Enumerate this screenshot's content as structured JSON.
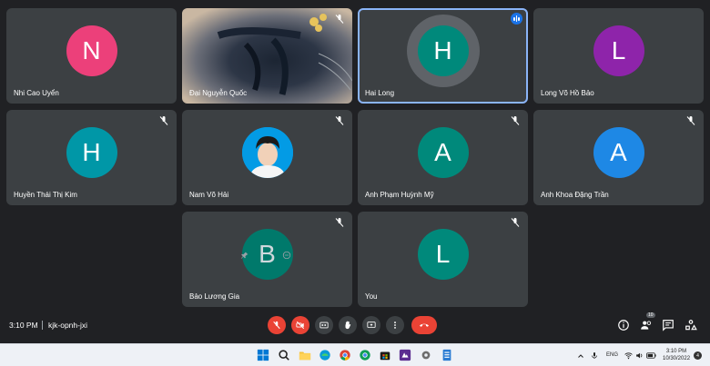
{
  "tiles": [
    {
      "name": "Nhi Cao Uyển",
      "initial": "N",
      "color": "#ec407a",
      "muted": false
    },
    {
      "name": "Đại Nguyễn Quốc",
      "initial": "",
      "color": "",
      "muted": true
    },
    {
      "name": "Hai Long",
      "initial": "H",
      "color": "#00897b",
      "muted": false,
      "speaking": true
    },
    {
      "name": "Long Võ Hồ Bảo",
      "initial": "L",
      "color": "#8e24aa",
      "muted": false
    },
    {
      "name": "Huyền Thái Thị Kim",
      "initial": "H",
      "color": "#0097a7",
      "muted": true
    },
    {
      "name": "Nam Võ Hải",
      "initial": "",
      "color": "#039be5",
      "muted": true
    },
    {
      "name": "Anh Phạm Huỳnh Mỹ",
      "initial": "A",
      "color": "#00897b",
      "muted": true
    },
    {
      "name": "Anh Khoa Đặng Trần",
      "initial": "A",
      "color": "#1e88e5",
      "muted": true
    },
    {
      "name": "Bảo Lương Gia",
      "initial": "B",
      "color": "#00796b",
      "muted": true
    },
    {
      "name": "You",
      "initial": "L",
      "color": "#00897b",
      "muted": true
    }
  ],
  "meeting": {
    "time": "3:10 PM",
    "code": "kjk-opnh-jxi"
  },
  "people_count": "10",
  "taskbar": {
    "lang": "ENG",
    "time": "3:10 PM",
    "date": "10/30/2022",
    "notifications": "4"
  },
  "colors": {
    "background": "#202124",
    "tile": "#3c4043",
    "red": "#ea4335",
    "active_outline": "#8ab4f8"
  }
}
